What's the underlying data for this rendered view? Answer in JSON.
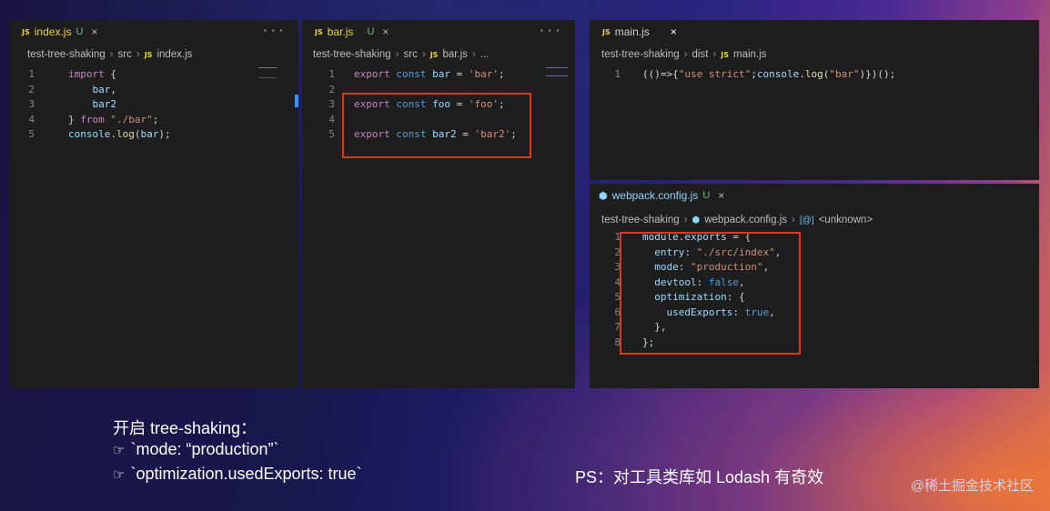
{
  "panel_left": {
    "tab": {
      "badge": "JS",
      "name": "index.js",
      "status": "U",
      "close": "×"
    },
    "menu": "···",
    "breadcrumb": [
      "test-tree-shaking",
      "src",
      "index.js"
    ],
    "breadcrumb_badge": "JS",
    "lines": [
      {
        "n": "1",
        "tokens": [
          {
            "t": "import",
            "c": "kw"
          },
          {
            "t": " {",
            "c": "pun"
          }
        ]
      },
      {
        "n": "2",
        "tokens": [
          {
            "t": "    bar",
            "c": "id"
          },
          {
            "t": ",",
            "c": "pun"
          }
        ]
      },
      {
        "n": "3",
        "tokens": [
          {
            "t": "    bar2",
            "c": "id"
          }
        ]
      },
      {
        "n": "4",
        "tokens": [
          {
            "t": "} ",
            "c": "pun"
          },
          {
            "t": "from",
            "c": "kw"
          },
          {
            "t": " \"./bar\"",
            "c": "str"
          },
          {
            "t": ";",
            "c": "pun"
          }
        ]
      },
      {
        "n": "5",
        "tokens": [
          {
            "t": "console",
            "c": "id"
          },
          {
            "t": ".",
            "c": "pun"
          },
          {
            "t": "log",
            "c": "fn"
          },
          {
            "t": "(",
            "c": "pun"
          },
          {
            "t": "bar",
            "c": "id"
          },
          {
            "t": ");",
            "c": "pun"
          }
        ]
      }
    ]
  },
  "panel_mid": {
    "tab": {
      "badge": "JS",
      "name": "bar.js",
      "status": "U",
      "close": "×"
    },
    "menu": "···",
    "breadcrumb": [
      "test-tree-shaking",
      "src",
      "bar.js",
      "..."
    ],
    "breadcrumb_badge": "JS",
    "lines": [
      {
        "n": "1",
        "tokens": [
          {
            "t": "export",
            "c": "kw"
          },
          {
            "t": " const",
            "c": "kw2"
          },
          {
            "t": " bar",
            "c": "id"
          },
          {
            "t": " = ",
            "c": "pun"
          },
          {
            "t": "'bar'",
            "c": "str"
          },
          {
            "t": ";",
            "c": "pun"
          }
        ]
      },
      {
        "n": "2",
        "tokens": []
      },
      {
        "n": "3",
        "tokens": [
          {
            "t": "export",
            "c": "kw"
          },
          {
            "t": " const",
            "c": "kw2"
          },
          {
            "t": " foo",
            "c": "id"
          },
          {
            "t": " = ",
            "c": "pun"
          },
          {
            "t": "'foo'",
            "c": "str"
          },
          {
            "t": ";",
            "c": "pun"
          }
        ]
      },
      {
        "n": "4",
        "tokens": []
      },
      {
        "n": "5",
        "tokens": [
          {
            "t": "export",
            "c": "kw"
          },
          {
            "t": " const",
            "c": "kw2"
          },
          {
            "t": " bar2",
            "c": "id"
          },
          {
            "t": " = ",
            "c": "pun"
          },
          {
            "t": "'bar2'",
            "c": "str"
          },
          {
            "t": ";",
            "c": "pun"
          }
        ]
      }
    ]
  },
  "panel_right_top": {
    "tab": {
      "badge": "JS",
      "name": "main.js",
      "close": "×"
    },
    "breadcrumb": [
      "test-tree-shaking",
      "dist",
      "main.js"
    ],
    "breadcrumb_badge": "JS",
    "lines": [
      {
        "n": "1",
        "tokens": [
          {
            "t": "(()=>{",
            "c": "pun"
          },
          {
            "t": "\"use strict\"",
            "c": "str"
          },
          {
            "t": ";",
            "c": "pun"
          },
          {
            "t": "console",
            "c": "id"
          },
          {
            "t": ".",
            "c": "pun"
          },
          {
            "t": "log",
            "c": "fn"
          },
          {
            "t": "(",
            "c": "pun"
          },
          {
            "t": "\"bar\"",
            "c": "str"
          },
          {
            "t": ")})();",
            "c": "pun"
          }
        ]
      }
    ]
  },
  "panel_right_bottom": {
    "tab": {
      "name": "webpack.config.js",
      "status": "U",
      "close": "×"
    },
    "breadcrumb": [
      "test-tree-shaking",
      "webpack.config.js",
      "<unknown>"
    ],
    "breadcrumb_badge": "[@]",
    "lines": [
      {
        "n": "1",
        "tokens": [
          {
            "t": "module",
            "c": "id"
          },
          {
            "t": ".",
            "c": "pun"
          },
          {
            "t": "exports",
            "c": "id"
          },
          {
            "t": " = {",
            "c": "pun"
          }
        ]
      },
      {
        "n": "2",
        "tokens": [
          {
            "t": "  entry",
            "c": "id"
          },
          {
            "t": ": ",
            "c": "pun"
          },
          {
            "t": "\"./src/index\"",
            "c": "str"
          },
          {
            "t": ",",
            "c": "pun"
          }
        ]
      },
      {
        "n": "3",
        "tokens": [
          {
            "t": "  mode",
            "c": "id"
          },
          {
            "t": ": ",
            "c": "pun"
          },
          {
            "t": "\"production\"",
            "c": "str"
          },
          {
            "t": ",",
            "c": "pun"
          }
        ]
      },
      {
        "n": "4",
        "tokens": [
          {
            "t": "  devtool",
            "c": "id"
          },
          {
            "t": ": ",
            "c": "pun"
          },
          {
            "t": "false",
            "c": "kw2"
          },
          {
            "t": ",",
            "c": "pun"
          }
        ]
      },
      {
        "n": "5",
        "tokens": [
          {
            "t": "  optimization",
            "c": "id"
          },
          {
            "t": ": {",
            "c": "pun"
          }
        ]
      },
      {
        "n": "6",
        "tokens": [
          {
            "t": "    usedExports",
            "c": "id"
          },
          {
            "t": ": ",
            "c": "pun"
          },
          {
            "t": "true",
            "c": "kw2"
          },
          {
            "t": ",",
            "c": "pun"
          }
        ]
      },
      {
        "n": "7",
        "tokens": [
          {
            "t": "  },",
            "c": "pun"
          }
        ]
      },
      {
        "n": "8",
        "tokens": [
          {
            "t": "};",
            "c": "pun"
          }
        ]
      }
    ]
  },
  "caption": {
    "heading": "开启 tree-shaking：",
    "item1": "`mode: “production”`",
    "item2": "`optimization.usedExports: true`",
    "ps": "PS：对工具类库如 Lodash 有奇效",
    "bullet_icon": "pointing-hand-icon"
  },
  "watermark": "@稀土掘金技术社区"
}
